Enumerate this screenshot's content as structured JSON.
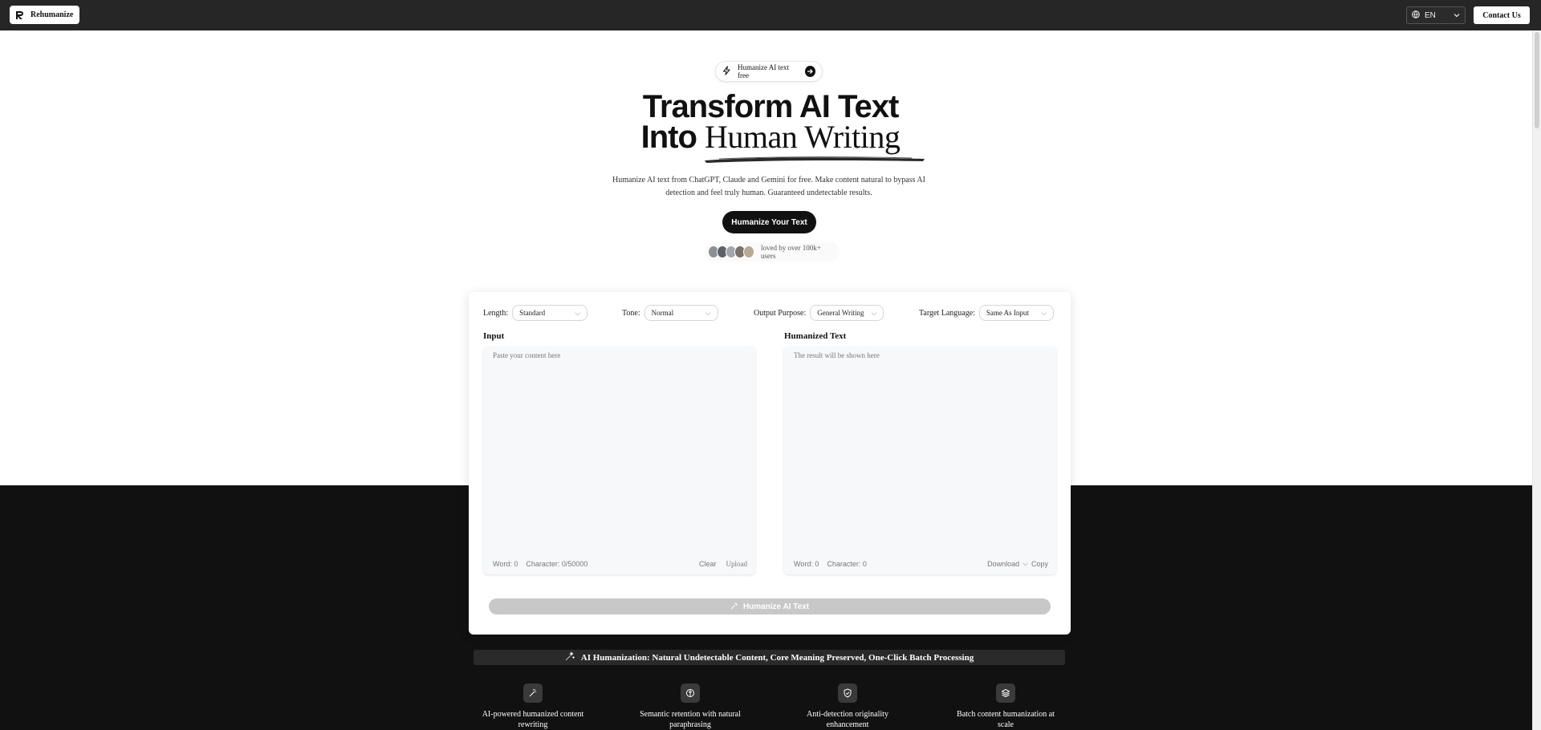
{
  "header": {
    "brand": "Rehumanize",
    "language": "EN",
    "contact_label": "Contact Us"
  },
  "hero": {
    "pill_label": "Humanize AI text free",
    "title_line1": "Transform AI Text",
    "title_line2_bold": "Into",
    "title_line2_serif": "Human Writing",
    "subtitle": "Humanize AI text from ChatGPT, Claude and Gemini for free. Make content natural to bypass AI detection and feel truly human. Guaranteed undetectable results.",
    "cta_label": "Humanize Your Text",
    "social_proof": "loved by over 100k+ users"
  },
  "tool": {
    "options": [
      {
        "label": "Length:",
        "value": "Standard"
      },
      {
        "label": "Tone:",
        "value": "Normal"
      },
      {
        "label": "Output Purpose:",
        "value": "General Writing"
      },
      {
        "label": "Target Language:",
        "value": "Same As Input"
      }
    ],
    "input": {
      "title": "Input",
      "placeholder": "Paste your content here",
      "word_count": "Word: 0",
      "char_count": "Character: 0/50000",
      "clear_label": "Clear",
      "upload_label": "Upload"
    },
    "output": {
      "title": "Humanized Text",
      "placeholder": "The result will be shown here",
      "word_count": "Word: 0",
      "char_count": "Character: 0",
      "download_label": "Download",
      "copy_label": "Copy"
    },
    "submit_label": "Humanize AI Text"
  },
  "features": {
    "banner": "AI Humanization: Natural Undetectable Content, Core Meaning Preserved, One-Click Batch Processing",
    "items": [
      {
        "label": "AI-powered humanized content rewriting",
        "icon": "wand-icon"
      },
      {
        "label": "Semantic retention with natural paraphrasing",
        "icon": "brain-icon"
      },
      {
        "label": "Anti-detection originality enhancement",
        "icon": "shield-icon"
      },
      {
        "label": "Batch content humanization at scale",
        "icon": "layers-icon"
      }
    ]
  },
  "colors": {
    "topbar": "#262626",
    "dark_section": "#111111",
    "cta": "#111111",
    "disabled_button": "#c8c8c8"
  }
}
